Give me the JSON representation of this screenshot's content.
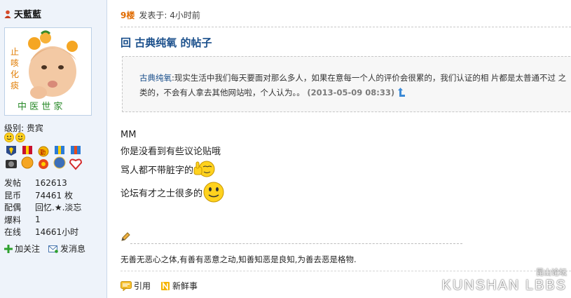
{
  "user": {
    "name": "天藍藍",
    "level_label": "级别:",
    "level_value": "贵宾",
    "stats": [
      {
        "key": "发帖",
        "value": "162613"
      },
      {
        "key": "昆币",
        "value": "74461 枚"
      },
      {
        "key": "配偶",
        "value": "回忆.★.淡忘"
      },
      {
        "key": "爆料",
        "value": "1"
      },
      {
        "key": "在线",
        "value": "14661小时"
      }
    ],
    "follow_label": "加关注",
    "message_label": "发消息",
    "avatar_caption": "中 医 世 家",
    "avatar_side": "止咳化痰"
  },
  "post": {
    "floor": "9楼",
    "posted_label": "发表于: 4小时前",
    "title": "回 古典纯氧 的帖子",
    "quote": {
      "author": "古典纯氧",
      "text": ":现实生活中我们每天要面对那么多人，如果在意每一个人的评价会很累的，我们认证的相 片都是太普通不过 之类的，不会有人拿去其他网站啦，个人认为。。",
      "date": "(2013-05-09 08:33)"
    },
    "lines": [
      "MM",
      "你是没看到有些议论贴哦",
      "骂人都不带脏字的",
      "论坛有才之士很多的"
    ],
    "signature": "无善无恶心之体,有善有恶意之动,知善知恶是良知,为善去恶是格物.",
    "quote_label": "引用",
    "news_label": "新鲜事"
  },
  "watermark": {
    "cn": "昆山论坛",
    "en": "KUNSHAN LBBS"
  },
  "colors": {
    "title": "#1a4f8b",
    "floor": "#e06b00",
    "panel": "#eef3fa"
  }
}
